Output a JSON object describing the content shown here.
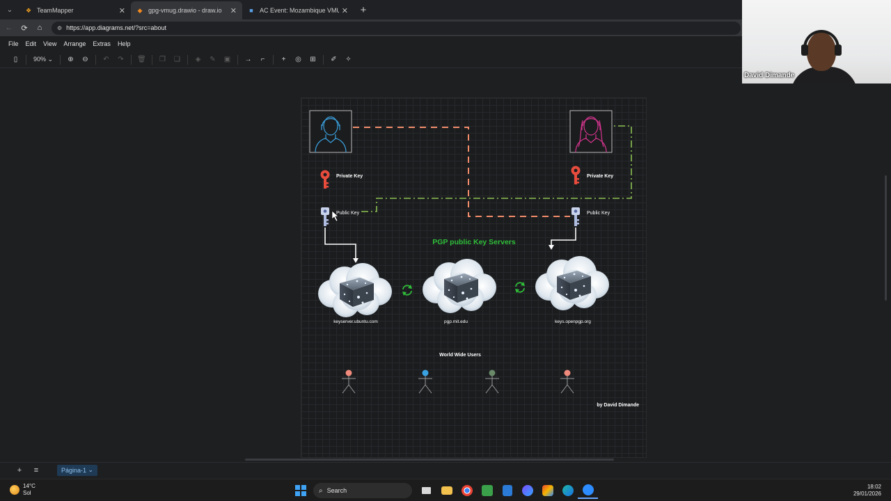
{
  "browser": {
    "tabs": [
      {
        "title": "TeamMapper"
      },
      {
        "title": "gpg-vmug.drawio - draw.io"
      },
      {
        "title": "AC Event: Mozambique VMUG: GF"
      }
    ],
    "url": "https://app.diagrams.net/?src=about"
  },
  "menu": [
    "File",
    "Edit",
    "View",
    "Arrange",
    "Extras",
    "Help"
  ],
  "toolbar": {
    "zoom": "90%"
  },
  "diagram": {
    "left_user": {
      "private_key_label": "Private Key",
      "public_key_label": "Public Key"
    },
    "right_user": {
      "private_key_label": "Private Key",
      "public_key_label": "Public Key"
    },
    "servers_title": "PGP public Key Servers",
    "servers": [
      {
        "label": "keyserver.ubuntu.com"
      },
      {
        "label": "pgp.mit.edu"
      },
      {
        "label": "keys.openpgp.org"
      }
    ],
    "users_title": "World Wide Users",
    "users": [
      {
        "color": "#f08a7c"
      },
      {
        "color": "#3aa2e0"
      },
      {
        "color": "#6a8a6a"
      },
      {
        "color": "#f08a7c"
      }
    ],
    "credit": "by David Dimande",
    "colors": {
      "red_dash": "#f28c6a",
      "green_dashdot": "#8cc152",
      "accent_green": "#2fbf3a",
      "key_red": "#e84c3d"
    }
  },
  "footer": {
    "page_tab": "Página-1"
  },
  "taskbar": {
    "temperature": "14°C",
    "weather": "Sol",
    "search_placeholder": "Search",
    "time": "18:02",
    "date": "29/01/2026"
  },
  "video": {
    "participant_name": "David Dimande"
  }
}
